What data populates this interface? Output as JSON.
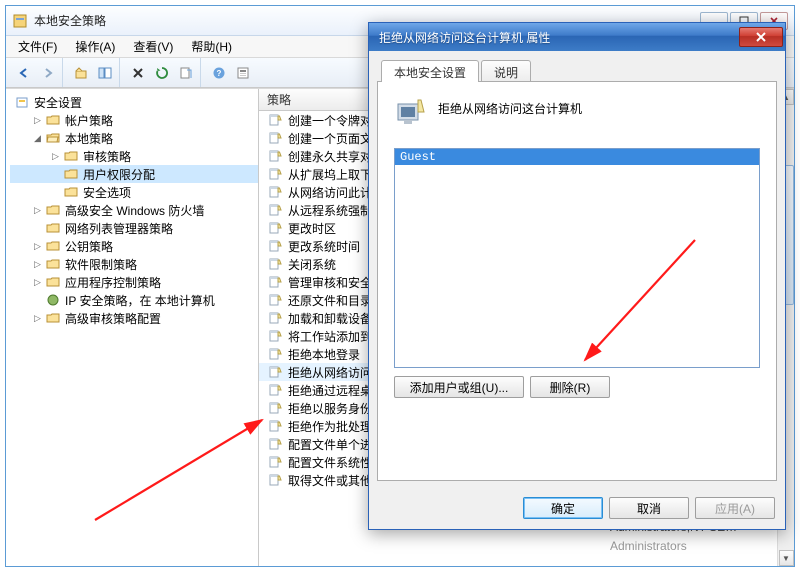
{
  "window": {
    "title": "本地安全策略"
  },
  "menu": {
    "file": "文件(F)",
    "action": "操作(A)",
    "view": "查看(V)",
    "help": "帮助(H)"
  },
  "tree": {
    "root": "安全设置",
    "items": [
      {
        "label": "帐户策略"
      },
      {
        "label": "本地策略",
        "children": [
          {
            "label": "审核策略"
          },
          {
            "label": "用户权限分配",
            "selected": true
          },
          {
            "label": "安全选项"
          }
        ]
      },
      {
        "label": "高级安全 Windows 防火墙"
      },
      {
        "label": "网络列表管理器策略"
      },
      {
        "label": "公钥策略"
      },
      {
        "label": "软件限制策略"
      },
      {
        "label": "应用程序控制策略"
      },
      {
        "label": "IP 安全策略，在 本地计算机"
      },
      {
        "label": "高级审核策略配置"
      }
    ]
  },
  "listHeader": "策略",
  "policies": [
    "创建一个令牌对象",
    "创建一个页面文件",
    "创建永久共享对象",
    "从扩展坞上取下计算机",
    "从网络访问此计算机",
    "从远程系统强制关机",
    "更改时区",
    "更改系统时间",
    "关闭系统",
    "管理审核和安全日志",
    "还原文件和目录",
    "加载和卸载设备驱动程序",
    "将工作站添加到域",
    "拒绝本地登录",
    "拒绝从网络访问这台计算机",
    "拒绝通过远程桌面服务登录",
    "拒绝以服务身份登录",
    "拒绝作为批处理作业登录",
    "配置文件单个进程",
    "配置文件系统性能",
    "取得文件或其他对象的所有权"
  ],
  "belowDialogSecurity": {
    "row1": "Administrators,NT SE…",
    "row2": "Administrators"
  },
  "dialog": {
    "title": "拒绝从网络访问这台计算机 属性",
    "tabs": {
      "local": "本地安全设置",
      "explain": "说明"
    },
    "heading": "拒绝从网络访问这台计算机",
    "listItems": [
      "Guest"
    ],
    "addUser": "添加用户或组(U)...",
    "remove": "删除(R)",
    "ok": "确定",
    "cancel": "取消",
    "apply": "应用(A)"
  }
}
